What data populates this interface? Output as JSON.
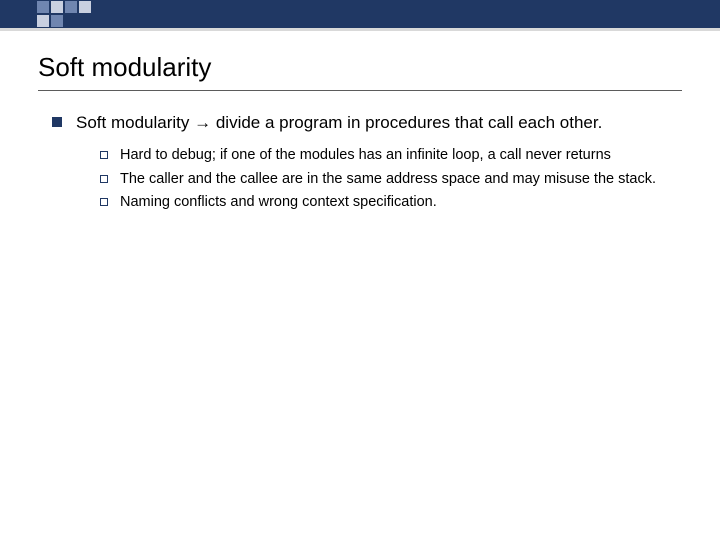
{
  "title": "Soft modularity",
  "main": {
    "prefix": "Soft modularity ",
    "arrow": "→",
    "suffix": " divide a program in procedures that call each other."
  },
  "subs": [
    "Hard to debug; if one of the modules has an infinite loop, a call never returns",
    "The caller and the callee are in the same address space and may misuse the stack.",
    "Naming conflicts and wrong context specification."
  ]
}
